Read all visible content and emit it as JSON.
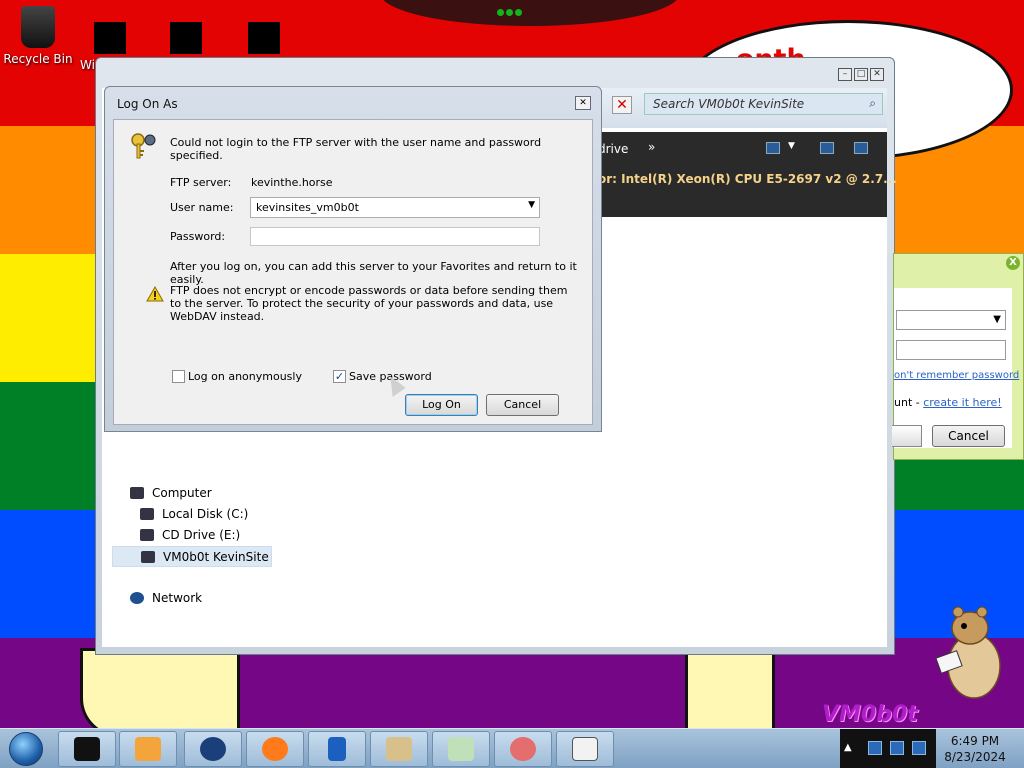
{
  "desktop": {
    "icons": [
      {
        "label": "Recycle Bin"
      },
      {
        "label": "Wi"
      }
    ],
    "bubble_text": "...onth",
    "watermark": "VM0b0t"
  },
  "explorer": {
    "search_placeholder": "Search VM0b0t KevinSite",
    "toolbar_drive": "drive",
    "toolbar_more": "»",
    "cpu_info": "or:  Intel(R) Xeon(R) CPU E5-2697 v2 @ 2.7...",
    "nav": [
      {
        "label": "Computer"
      },
      {
        "label": "Local Disk (C:)"
      },
      {
        "label": "CD Drive (E:)"
      },
      {
        "label": "VM0b0t KevinSite"
      },
      {
        "label": "Network"
      }
    ]
  },
  "login_partial": {
    "close": "X",
    "forgot_link": "on't remember password",
    "account_text": "unt - ",
    "create_link": "create it here!",
    "cancel": "Cancel"
  },
  "dialog": {
    "title": "Log On As",
    "message": "Could not login to the FTP server with the user name and password specified.",
    "server_label": "FTP server:",
    "server_value": "kevinthe.horse",
    "user_label": "User name:",
    "user_value": "kevinsites_vm0b0t",
    "password_label": "Password:",
    "password_value": "",
    "info": "After you log on, you can add this server to your Favorites and return to it easily.",
    "warning": "FTP does not encrypt or encode passwords or data before sending them to the server.  To protect the security of your passwords and data, use WebDAV instead.",
    "anon_label": "Log on anonymously",
    "anon_checked": false,
    "save_label": "Save password",
    "save_checked": true,
    "logon_button": "Log On",
    "cancel_button": "Cancel"
  },
  "taskbar": {
    "time": "6:49 PM",
    "date": "8/23/2024",
    "apps": [
      "terminal",
      "media-player",
      "browser-globe",
      "firefox",
      "tablet",
      "paint",
      "notepad",
      "snipping-tool",
      "solitaire"
    ]
  }
}
